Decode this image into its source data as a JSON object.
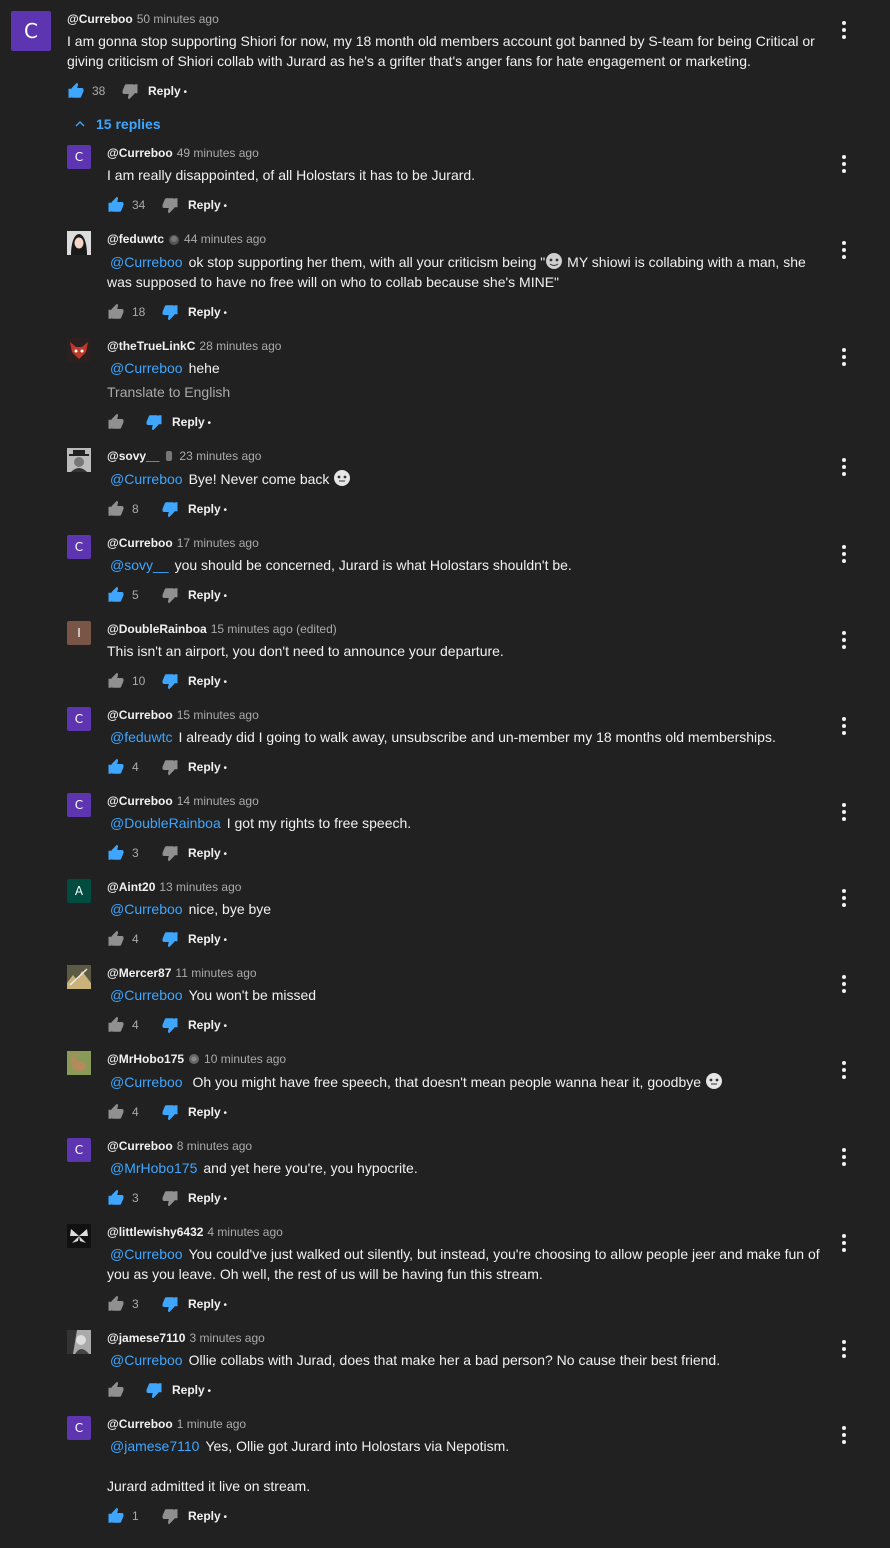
{
  "colors": {
    "background": "#212121",
    "link": "#3ea6ff",
    "like_active": "#3ea6ff",
    "icon_inactive": "#909090"
  },
  "top": {
    "avatar": "C",
    "author": "@Curreboo",
    "time": "50 minutes ago",
    "text": "I am gonna stop supporting Shiori for now, my 18 month old members account got banned by S-team for being Critical or giving criticism of Shiori collab with Jurard as he's a grifter that's anger fans for hate engagement or marketing.",
    "likes": "38",
    "reply": "Reply"
  },
  "replies_toggle": "15 replies",
  "replies": [
    {
      "avatar": "C",
      "author": "@Curreboo",
      "time": "49 minutes ago",
      "mention": "",
      "text": "I am really disappointed, of all Holostars it has to be Jurard.",
      "likes": "34",
      "reply": "Reply"
    },
    {
      "author": "@feduwtc",
      "time": "44 minutes ago",
      "mention": "@Curreboo",
      "text_a": "ok stop supporting her them, with all your criticism being \"",
      "text_b": " MY shiowi is collabing with a man, she was supposed to have no free will on who to collab because she's MINE\"",
      "likes": "18",
      "reply": "Reply"
    },
    {
      "author": "@theTrueLinkC",
      "time": "28 minutes ago",
      "mention": "@Curreboo",
      "text": "hehe",
      "translate": "Translate to English",
      "likes": "",
      "reply": "Reply"
    },
    {
      "author": "@sovy__",
      "time": "23 minutes ago",
      "mention": "@Curreboo",
      "text": "Bye! Never come back",
      "likes": "8",
      "reply": "Reply"
    },
    {
      "avatar": "C",
      "author": "@Curreboo",
      "time": "17 minutes ago",
      "mention": "@sovy__",
      "text": "you should be concerned, Jurard is what Holostars shouldn't be.",
      "likes": "5",
      "reply": "Reply"
    },
    {
      "avatar": "I",
      "author": "@DoubleRainboa",
      "time": "15 minutes ago (edited)",
      "mention": "",
      "text": "This isn't an airport, you don't need to announce your departure.",
      "likes": "10",
      "reply": "Reply"
    },
    {
      "avatar": "C",
      "author": "@Curreboo",
      "time": "15 minutes ago",
      "mention": "@feduwtc",
      "text": "I already did I going to walk away, unsubscribe and un-member my 18 months old memberships.",
      "likes": "4",
      "reply": "Reply"
    },
    {
      "avatar": "C",
      "author": "@Curreboo",
      "time": "14 minutes ago",
      "mention": "@DoubleRainboa",
      "text": "I got my rights to free speech.",
      "likes": "3",
      "reply": "Reply"
    },
    {
      "avatar": "A",
      "author": "@Aint20",
      "time": "13 minutes ago",
      "mention": "@Curreboo",
      "text": "nice, bye bye",
      "likes": "4",
      "reply": "Reply"
    },
    {
      "author": "@Mercer87",
      "time": "11 minutes ago",
      "mention": "@Curreboo",
      "text": "You won't be missed",
      "likes": "4",
      "reply": "Reply"
    },
    {
      "author": "@MrHobo175",
      "time": "10 minutes ago",
      "mention": "@Curreboo",
      "text": " Oh you might have free speech, that doesn't mean people wanna hear it, goodbye",
      "likes": "4",
      "reply": "Reply"
    },
    {
      "avatar": "C",
      "author": "@Curreboo",
      "time": "8 minutes ago",
      "mention": "@MrHobo175",
      "text": "and yet here you're, you hypocrite.",
      "likes": "3",
      "reply": "Reply"
    },
    {
      "author": "@littlewishy6432",
      "time": "4 minutes ago",
      "mention": "@Curreboo",
      "text": "You could've just walked out silently, but instead, you're choosing to allow people jeer and make fun of you as you leave. Oh well, the rest of us will be having fun this stream.",
      "likes": "3",
      "reply": "Reply"
    },
    {
      "author": "@jamese7110",
      "time": "3 minutes ago",
      "mention": "@Curreboo",
      "text": "Ollie collabs with Jurad, does that make her a bad person? No cause their best friend.",
      "likes": "",
      "reply": "Reply"
    },
    {
      "avatar": "C",
      "author": "@Curreboo",
      "time": "1 minute ago",
      "mention": "@jamese7110",
      "text": "Yes, Ollie got Jurard into Holostars via Nepotism.",
      "text2": "Jurard admitted it live on stream.",
      "likes": "1",
      "reply": "Reply"
    }
  ]
}
